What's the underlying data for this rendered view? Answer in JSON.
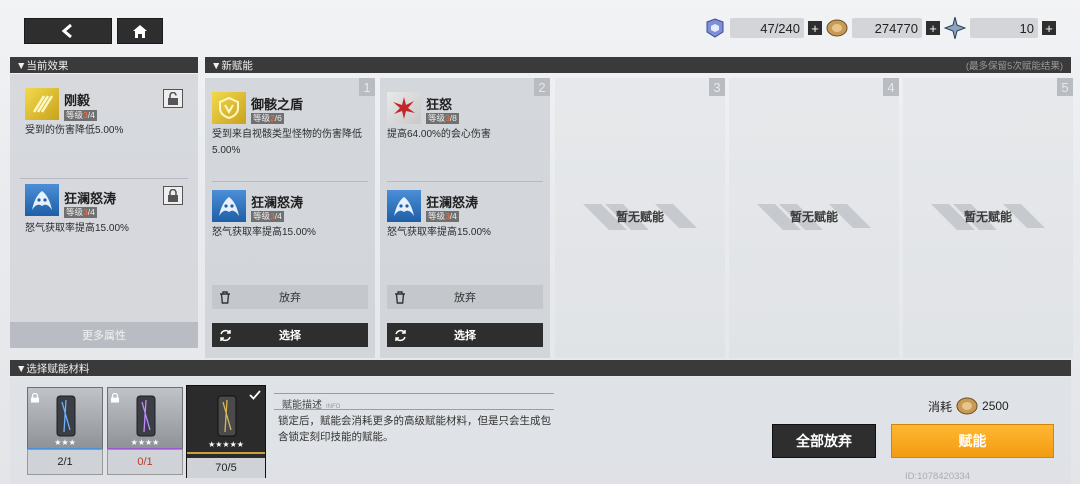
{
  "nav": {
    "back_icon": "back-arrow-icon",
    "home_icon": "home-icon"
  },
  "resources": [
    {
      "icon": "energy-crystal-icon",
      "value": "47/240"
    },
    {
      "icon": "coin-icon",
      "value": "274770"
    },
    {
      "icon": "star-shard-icon",
      "value": "10"
    }
  ],
  "sections": {
    "current": "▼当前效果",
    "new": "▼新赋能",
    "new_note": "(最多保留5次赋能结果)",
    "materials": "▼选择赋能材料"
  },
  "current_effects": {
    "skills": [
      {
        "name": "刚毅",
        "level_label": "等级",
        "level_cur": "3",
        "level_max": "/4",
        "desc": "受到的伤害降低5.00%",
        "icon": "fortitude-icon",
        "lock": "unlocked"
      },
      {
        "name": "狂澜怒涛",
        "level_label": "等级",
        "level_cur": "3",
        "level_max": "/4",
        "desc": "怒气获取率提高15.00%",
        "icon": "raging-wave-icon",
        "lock": "locked"
      }
    ],
    "more_label": "更多属性"
  },
  "slots": [
    {
      "number": "1",
      "skills": [
        {
          "name": "御骸之盾",
          "level_label": "等级",
          "level_cur": "2",
          "level_max": "/6",
          "desc": "受到来自视骸类型怪物的伤害降低5.00%",
          "icon": "shield-icon"
        },
        {
          "name": "狂澜怒涛",
          "level_label": "等级",
          "level_cur": "3",
          "level_max": "/4",
          "desc": "怒气获取率提高15.00%",
          "icon": "raging-wave-icon"
        }
      ],
      "discard_label": "放弃",
      "select_label": "选择"
    },
    {
      "number": "2",
      "skills": [
        {
          "name": "狂怒",
          "level_label": "等级",
          "level_cur": "3",
          "level_max": "/8",
          "desc": "提高64.00%的会心伤害",
          "icon": "rage-icon"
        },
        {
          "name": "狂澜怒涛",
          "level_label": "等级",
          "level_cur": "3",
          "level_max": "/4",
          "desc": "怒气获取率提高15.00%",
          "icon": "raging-wave-icon"
        }
      ],
      "discard_label": "放弃",
      "select_label": "选择"
    },
    {
      "number": "3",
      "empty_label": "暂无赋能"
    },
    {
      "number": "4",
      "empty_label": "暂无赋能"
    },
    {
      "number": "5",
      "empty_label": "暂无赋能"
    }
  ],
  "materials": {
    "items": [
      {
        "count": "2/1",
        "stars": "★★★",
        "rarity_color": "#4a90d9",
        "locked": true,
        "selected": false
      },
      {
        "count": "0/1",
        "stars": "★★★★",
        "rarity_color": "#9b59d0",
        "locked": true,
        "selected": false
      },
      {
        "count": "70/5",
        "stars": "★★★★★",
        "rarity_color": "#c8a33a",
        "locked": false,
        "selected": true
      }
    ],
    "desc_title": "赋能描述",
    "desc_sub": "INFO",
    "desc_text": "锁定后，赋能会消耗更多的高级赋能材料，但是只会生成包含锁定刻印技能的赋能。"
  },
  "footer": {
    "cost_label": "消耗",
    "cost_value": "2500",
    "discard_all_label": "全部放弃",
    "enhance_label": "赋能",
    "id_text": "ID:1078420334",
    "accent": "#f5a623"
  }
}
